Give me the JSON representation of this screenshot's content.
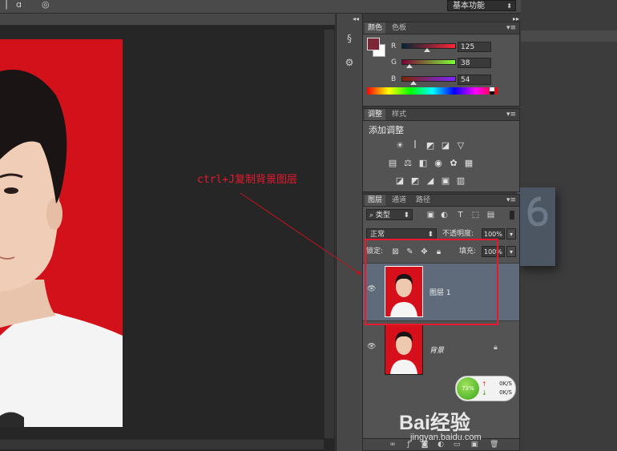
{
  "topbar": {
    "workspace": "基本功能"
  },
  "color_panel": {
    "tabs": [
      "颜色",
      "色板"
    ],
    "foreground": "#7d2636",
    "channels": [
      {
        "label": "R",
        "value": "125",
        "fraction": 0.49
      },
      {
        "label": "G",
        "value": "38",
        "fraction": 0.15
      },
      {
        "label": "B",
        "value": "54",
        "fraction": 0.21
      }
    ]
  },
  "adjustments_panel": {
    "tabs": [
      "调整",
      "样式"
    ],
    "title": "添加调整"
  },
  "layers_panel": {
    "tabs": [
      "图层",
      "通道",
      "路径"
    ],
    "filter_kind": "类型",
    "blend_mode": "正常",
    "opacity_label": "不透明度:",
    "opacity_value": "100%",
    "lock_label": "锁定:",
    "fill_label": "填充:",
    "fill_value": "100%",
    "layers": [
      {
        "name": "图层 1",
        "selected": true
      },
      {
        "name": "背景",
        "selected": false
      }
    ]
  },
  "annotation": {
    "text": "ctrl+J复制背景图层",
    "color": "#e8192c"
  },
  "net_widget": {
    "percent": "73%",
    "up": "0K/S",
    "down": "0K/S"
  },
  "watermark": {
    "brand": "Bai经验",
    "url": "jingyan.baidu.com"
  }
}
